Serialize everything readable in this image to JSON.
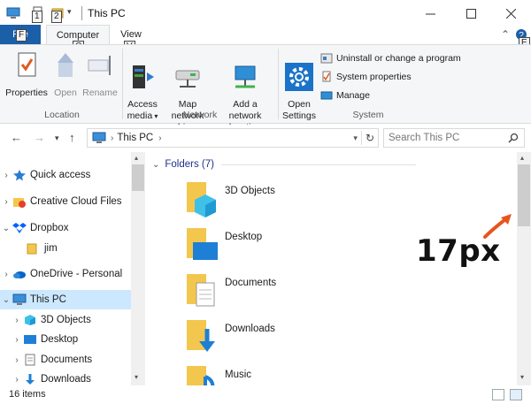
{
  "window": {
    "title": "This PC",
    "keytips": [
      "1",
      "2",
      "F",
      "C",
      "V",
      "E"
    ]
  },
  "tabs": {
    "file": "File",
    "computer": "Computer",
    "view": "View"
  },
  "ribbon": {
    "location": {
      "label": "Location",
      "properties": "Properties",
      "open": "Open",
      "rename": "Rename"
    },
    "network": {
      "label": "Network",
      "access_media": "Access\nmedia",
      "map_drive": "Map network\ndrive",
      "add_location": "Add a network\nlocation"
    },
    "system": {
      "label": "System",
      "open_settings": "Open\nSettings",
      "uninstall": "Uninstall or change a program",
      "system_properties": "System properties",
      "manage": "Manage"
    }
  },
  "address": {
    "crumb": "This PC",
    "search_placeholder": "Search This PC"
  },
  "nav": {
    "items": [
      {
        "label": "Quick access",
        "icon": "star-icon",
        "expander": ">"
      },
      {
        "label": "Creative Cloud Files",
        "icon": "creative-cloud-icon",
        "expander": ">"
      },
      {
        "label": "Dropbox",
        "icon": "dropbox-icon",
        "expander": "v"
      },
      {
        "label": "jim",
        "icon": "folder-icon",
        "expander": ""
      },
      {
        "label": "OneDrive - Personal",
        "icon": "onedrive-icon",
        "expander": ">"
      },
      {
        "label": "This PC",
        "icon": "computer-icon",
        "expander": "v"
      },
      {
        "label": "3D Objects",
        "icon": "cube-icon",
        "expander": ">"
      },
      {
        "label": "Desktop",
        "icon": "desktop-icon",
        "expander": ">"
      },
      {
        "label": "Documents",
        "icon": "documents-icon",
        "expander": ">"
      },
      {
        "label": "Downloads",
        "icon": "downloads-icon",
        "expander": ">"
      }
    ]
  },
  "content": {
    "group_header": "Folders (7)",
    "folders": [
      {
        "name": "3D Objects"
      },
      {
        "name": "Desktop"
      },
      {
        "name": "Documents"
      },
      {
        "name": "Downloads"
      },
      {
        "name": "Music"
      }
    ]
  },
  "annotation": {
    "text": "17px",
    "color": "#e8541e"
  },
  "status": {
    "count": "16 items"
  },
  "colors": {
    "accent": "#1a5fa8",
    "selected": "#cce8ff",
    "folder": "#f3c74d"
  }
}
